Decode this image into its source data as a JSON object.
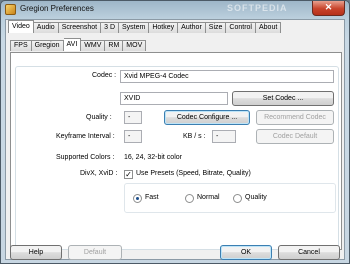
{
  "window": {
    "title": "Gregion Preferences",
    "watermark": "SOFTPEDIA",
    "close_glyph": "✕"
  },
  "top_tabs": [
    "Video",
    "Audio",
    "Screenshot",
    "3 D",
    "System",
    "Hotkey",
    "Author",
    "Size",
    "Control",
    "About"
  ],
  "top_tabs_active": "Video",
  "sub_tabs": [
    "FPS",
    "Gregion",
    "AVI",
    "WMV",
    "RM",
    "MOV"
  ],
  "sub_tabs_active": "AVI",
  "avi": {
    "codec_label": "Codec :",
    "codec_name": "Xvid MPEG-4 Codec",
    "codec_id": "XVID",
    "set_codec_button": "Set Codec ...",
    "quality_label": "Quality :",
    "quality_value": "-",
    "codec_configure_button": "Codec Configure ...",
    "recommend_codec_button": "Recommend Codec",
    "keyframe_label": "Keyframe Interval :",
    "keyframe_value": "-",
    "kbs_label": "KB / s :",
    "kbs_value": "-",
    "codec_default_button": "Codec Default",
    "supported_colors_label": "Supported Colors :",
    "supported_colors_value": "16, 24, 32-bit color",
    "divx_label": "DivX, XviD :",
    "use_presets_label": "Use Presets (Speed, Bitrate, Quality)",
    "use_presets_checked": true,
    "presets": [
      "Fast",
      "Normal",
      "Quality"
    ],
    "preset_selected": "Fast"
  },
  "footer": {
    "help": "Help",
    "default": "Default",
    "ok": "OK",
    "cancel": "Cancel"
  }
}
